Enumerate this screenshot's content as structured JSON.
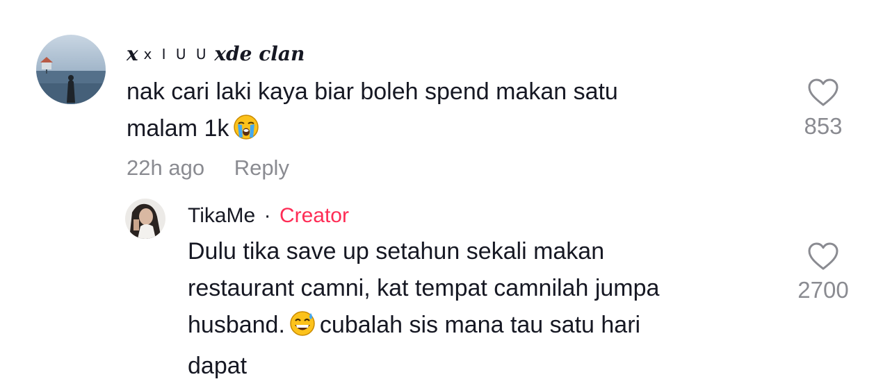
{
  "comments": {
    "top": {
      "username_prefix": "x I U U",
      "username_main": "xde clan",
      "text_line1": "nak cari laki kaya biar boleh spend makan satu",
      "text_line2": "malam 1k",
      "emoji": "loudly-crying-face",
      "timestamp": "22h ago",
      "reply_label": "Reply",
      "likes": "853",
      "heart_icon": "heart-outline-icon"
    },
    "reply": {
      "username": "TikaMe",
      "separator": "·",
      "badge": "Creator",
      "text_line1": "Dulu tika save up setahun sekali makan",
      "text_line2": "restaurant camni, kat tempat camnilah jumpa",
      "text_line3_before": "husband.",
      "text_line3_after": "cubalah sis mana tau satu hari",
      "text_line4": "dapat",
      "emoji": "grinning-face-with-sweat",
      "likes": "2700",
      "heart_icon": "heart-outline-icon"
    }
  },
  "colors": {
    "text": "#161823",
    "muted": "#8a8b91",
    "creator": "#fe2c55"
  }
}
